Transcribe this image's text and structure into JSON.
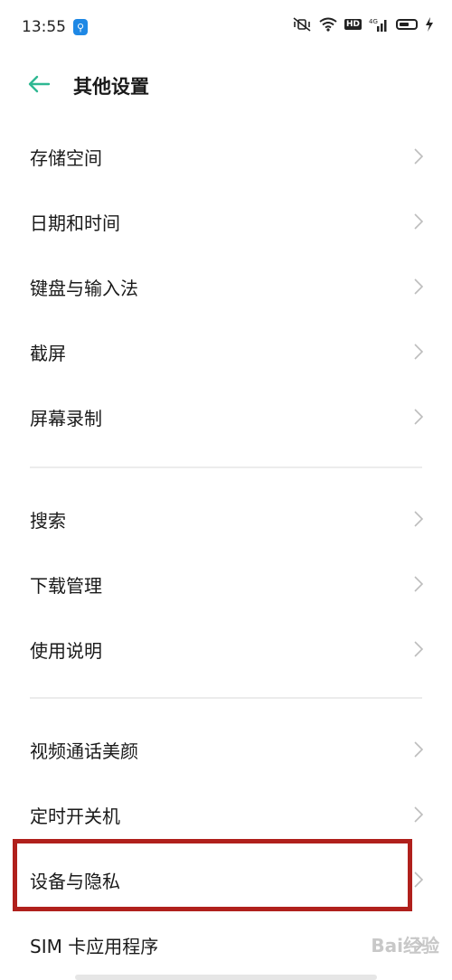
{
  "status_bar": {
    "time": "13:55",
    "hd": "HD",
    "network": "4G"
  },
  "header": {
    "title": "其他设置"
  },
  "groups": [
    {
      "items": [
        {
          "label": "存储空间"
        },
        {
          "label": "日期和时间"
        },
        {
          "label": "键盘与输入法"
        },
        {
          "label": "截屏"
        },
        {
          "label": "屏幕录制"
        }
      ]
    },
    {
      "items": [
        {
          "label": "搜索"
        },
        {
          "label": "下载管理"
        },
        {
          "label": "使用说明"
        }
      ]
    },
    {
      "items": [
        {
          "label": "视频通话美颜"
        },
        {
          "label": "定时开关机"
        },
        {
          "label": "设备与隐私"
        },
        {
          "label": "SIM 卡应用程序"
        }
      ]
    }
  ],
  "watermark": "Bai经验",
  "colors": {
    "accent": "#2fb892",
    "highlight": "#b0201c"
  }
}
